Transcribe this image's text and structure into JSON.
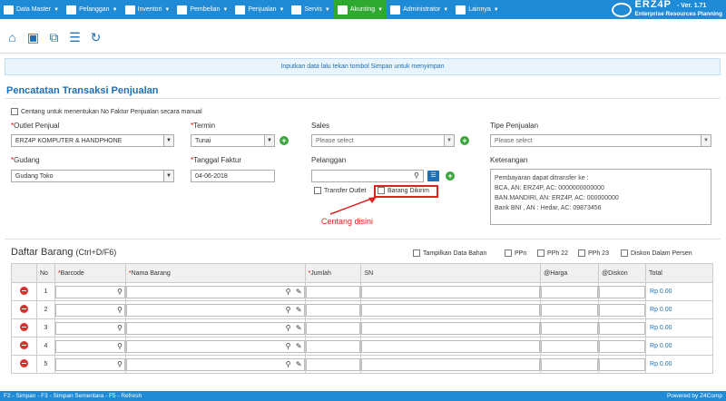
{
  "nav": {
    "items": [
      {
        "label": "Data Master",
        "icon": "grid-icon"
      },
      {
        "label": "Pelanggan",
        "icon": "users-icon"
      },
      {
        "label": "Inventori",
        "icon": "box-icon"
      },
      {
        "label": "Pembelian",
        "icon": "cart-icon"
      },
      {
        "label": "Penjualan",
        "icon": "document-icon"
      },
      {
        "label": "Servis",
        "icon": "gears-icon"
      },
      {
        "label": "Akunting",
        "icon": "ledger-icon"
      },
      {
        "label": "Administrator",
        "icon": "gear-icon"
      },
      {
        "label": "Lainnya",
        "icon": "list-icon"
      }
    ],
    "active_index": 6,
    "brand_name": "ERZ4P",
    "brand_version": "- Ver. 1.71",
    "brand_subtitle": "Enterprise Resources Planning"
  },
  "notice": "Inputkan data lalu tekan tombol Simpan untuk menyimpan",
  "section_title": "Pencatatan Transaksi Penjualan",
  "manual_invoice_label": "Centang untuk menentukan No Faktur Penjualan secara manual",
  "form": {
    "outlet_label": "Outlet Penjual",
    "outlet_value": "ERZ4P KOMPUTER & HANDPHONE",
    "termin_label": "Termin",
    "termin_value": "Tunai",
    "sales_label": "Sales",
    "sales_placeholder": "Please select",
    "tipe_label": "Tipe Penjualan",
    "tipe_placeholder": "Please select",
    "gudang_label": "Gudang",
    "gudang_value": "Gudang Toko",
    "tanggal_label": "Tanggal Faktur",
    "tanggal_value": "04-06-2018",
    "pelanggan_label": "Pelanggan",
    "pelanggan_value": "",
    "transfer_outlet_label": "Transfer Outlet",
    "barang_dikirim_label": "Barang Dikirim",
    "keterangan_label": "Keterangan",
    "keterangan_lines": [
      "Pembayaran dapat ditransfer ke :",
      "BCA, AN: ERZ4P, AC: 0000000000000",
      "BAN.MANDIRI, AN: ERZ4P, AC: 000000000",
      "Bank BNI , AN : Hedar, AC: 09873456"
    ]
  },
  "callout_text": "Centang disini",
  "list": {
    "title": "Daftar Barang",
    "shortcut": "(Ctrl+D/F6)",
    "options": [
      "Tampilkan Data Bahan",
      "PPn",
      "PPh 22",
      "PPh 23",
      "Diskon Dalam Persen"
    ],
    "columns": [
      "No",
      "Barcode",
      "Nama Barang",
      "Jumlah",
      "SN",
      "@Harga",
      "@Diskon",
      "Total"
    ],
    "rows": [
      {
        "no": "1",
        "total": "Rp 0.00"
      },
      {
        "no": "2",
        "total": "Rp 0.00"
      },
      {
        "no": "3",
        "total": "Rp 0.00"
      },
      {
        "no": "4",
        "total": "Rp 0.00"
      },
      {
        "no": "5",
        "total": "Rp 0.00"
      }
    ]
  },
  "footer": {
    "shortcuts": "F2 - Simpan - F3 - Simpan Sementara - F5 - Refresh",
    "credit": "Powered by Z4Comp"
  }
}
